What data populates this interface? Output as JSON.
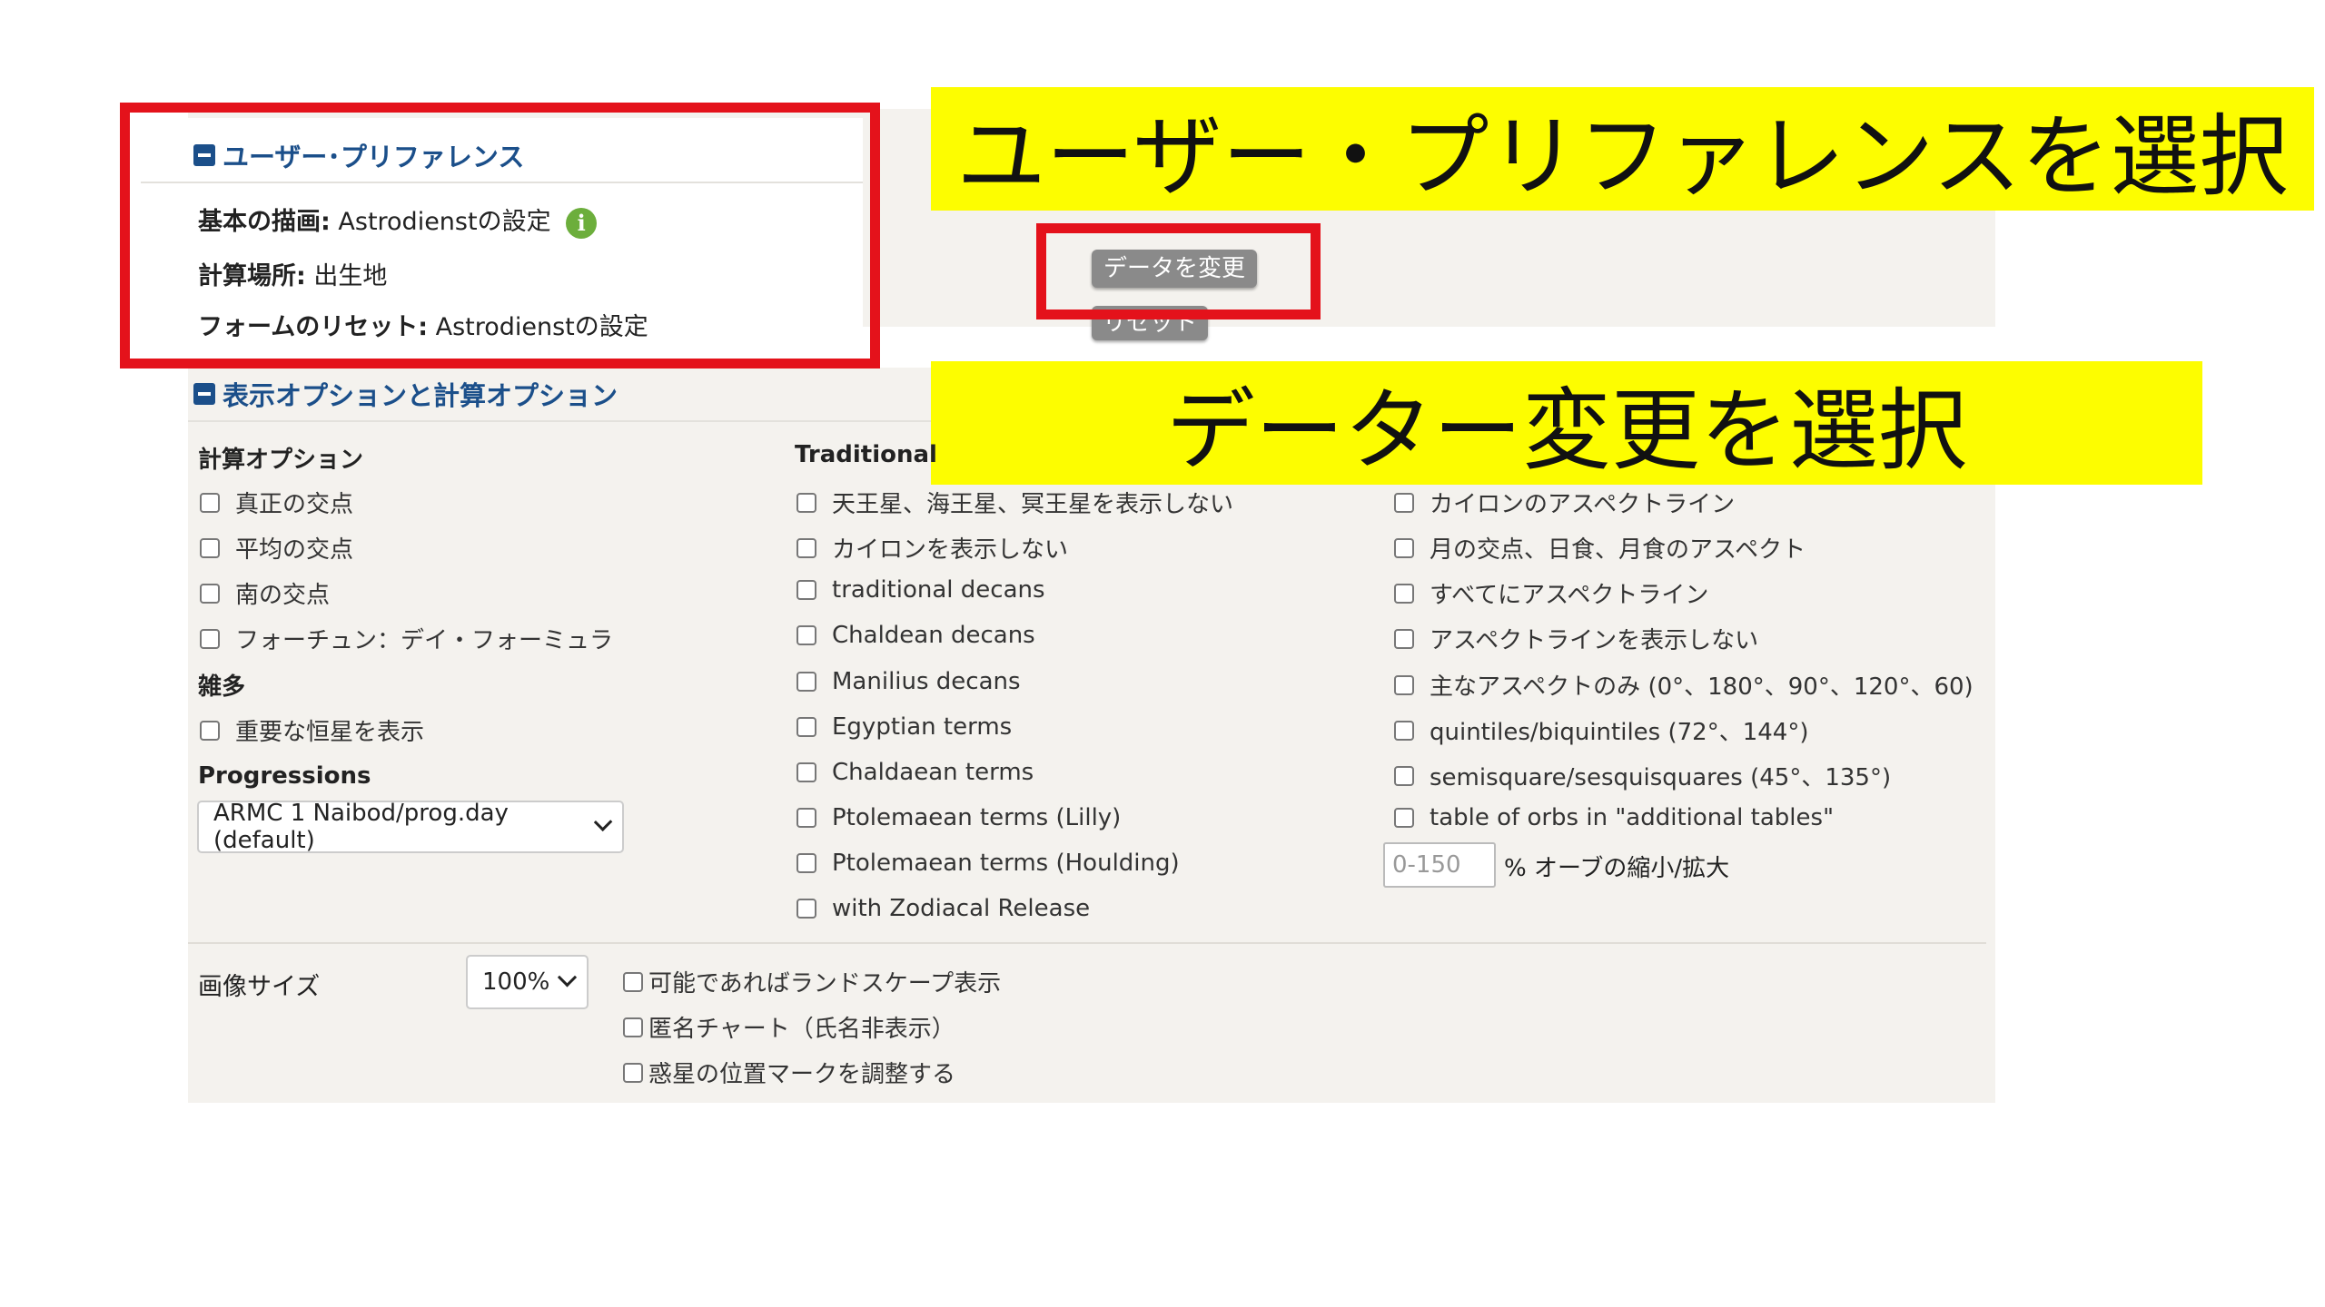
{
  "user_pref": {
    "title": "ユーザー･プリファレンス",
    "basic_drawing_label": "基本の描画:",
    "basic_drawing_value": "Astrodienstの設定",
    "calc_place_label": "計算場所:",
    "calc_place_value": "出生地",
    "form_reset_label": "フォームのリセット:",
    "form_reset_value": "Astrodienstの設定"
  },
  "buttons": {
    "change_data": "データを変更",
    "reset": "リセット"
  },
  "annotations": {
    "select_user_pref": "ユーザー・プリファレンスを選択",
    "select_data_change": "データー変更を選択",
    "frame_color": "#e4121b",
    "callout_color": "#fdfd00"
  },
  "options": {
    "title": "表示オプションと計算オプション",
    "calc_heading": "計算オプション",
    "calc_items": [
      "真正の交点",
      "平均の交点",
      "南の交点",
      "フォーチュン：デイ・フォーミュラ"
    ],
    "misc_heading": "雑多",
    "misc_items": [
      "重要な恒星を表示"
    ],
    "progressions_heading": "Progressions",
    "progressions_value": "ARMC 1 Naibod/prog.day (default)",
    "traditional_heading": "Traditional",
    "traditional_items": [
      "天王星、海王星、冥王星を表示しない",
      "カイロンを表示しない",
      "traditional decans",
      "Chaldean decans",
      "Manilius decans",
      "Egyptian terms",
      "Chaldaean terms",
      "Ptolemaean terms (Lilly)",
      "Ptolemaean terms (Houlding)",
      "with Zodiacal Release"
    ],
    "aspect_items": [
      "カイロンのアスペクトライン",
      "月の交点、日食、月食のアスペクト",
      "すべてにアスペクトライン",
      "アスペクトラインを表示しない",
      "主なアスペクトのみ (0°、180°、90°、120°、60)",
      "quintiles/biquintiles (72°、144°)",
      "semisquare/sesquisquares (45°、135°)",
      "table of orbs in \"additional tables\""
    ],
    "orb_placeholder": "0-150",
    "orb_label": "% オーブの縮小/拡大",
    "image_size_label": "画像サイズ",
    "image_size_value": "100%",
    "display_items": [
      "可能であればランドスケープ表示",
      "匿名チャート（氏名非表示）",
      "惑星の位置マークを調整する"
    ]
  }
}
